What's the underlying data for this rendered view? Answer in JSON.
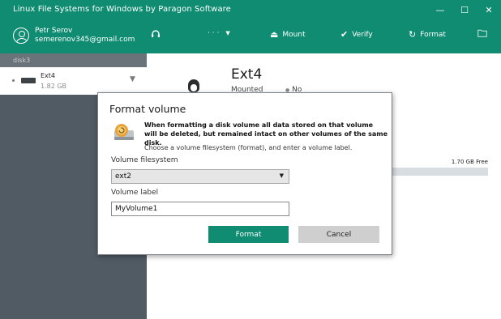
{
  "app": {
    "title": "Linux File Systems for Windows by Paragon Software",
    "window_controls": {
      "minimize": "—",
      "maximize": "☐",
      "close": "✕"
    }
  },
  "user": {
    "name": "Petr Serov",
    "email": "semerenov345@gmail.com"
  },
  "toolbar": {
    "more_label": "· · ·",
    "mount_label": "Mount",
    "verify_label": "Verify",
    "format_label": "Format"
  },
  "sidebar": {
    "disk_label": "disk3",
    "volume": {
      "name": "Ext4",
      "size": "1.82 GB"
    }
  },
  "main": {
    "volume_title": "Ext4",
    "mounted_label": "Mounted",
    "mounted_value": "No",
    "free_text": "1.70 GB Free"
  },
  "dialog": {
    "title": "Format volume",
    "warning": "When formatting a disk volume all data stored on that volume will be deleted, but remained intact on other volumes of the same disk.",
    "note": "Choose a volume filesystem (format), and enter a volume label.",
    "filesystem_label": "Volume filesystem",
    "filesystem_value": "ext2",
    "volume_label_label": "Volume label",
    "volume_label_value": "MyVolume1",
    "format_button": "Format",
    "cancel_button": "Cancel"
  },
  "colors": {
    "brand": "#0f8c72",
    "sidebar": "#505b63",
    "accent_icon": "#e9a23b"
  }
}
